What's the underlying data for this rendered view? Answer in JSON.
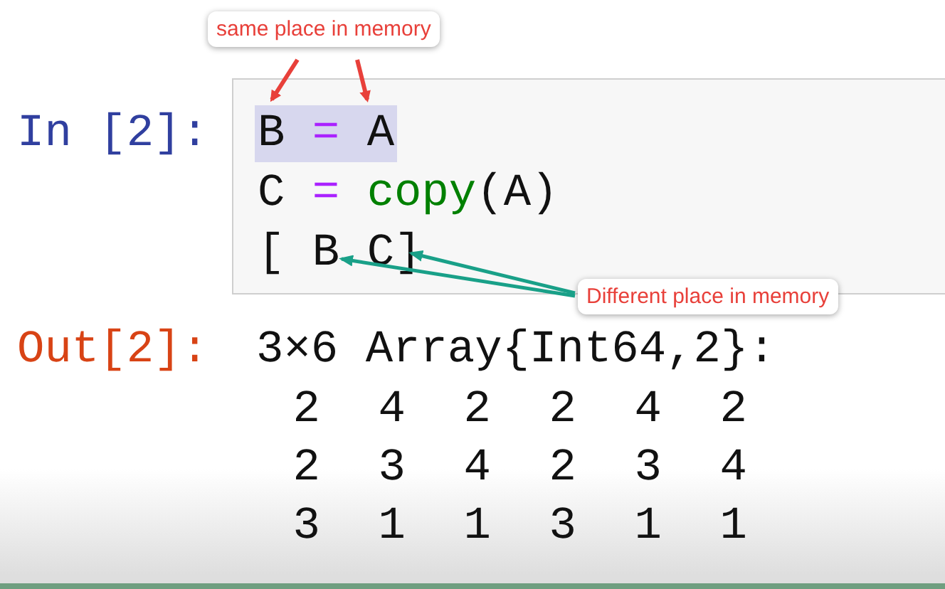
{
  "input_cell": {
    "prompt": "In [2]:",
    "lines": [
      {
        "highlighted": true,
        "tokens": [
          {
            "kind": "plain",
            "text": "B "
          },
          {
            "kind": "op",
            "text": "="
          },
          {
            "kind": "plain",
            "text": " A"
          }
        ]
      },
      {
        "highlighted": false,
        "tokens": [
          {
            "kind": "plain",
            "text": "C "
          },
          {
            "kind": "op",
            "text": "= "
          },
          {
            "kind": "func",
            "text": "copy"
          },
          {
            "kind": "plain",
            "text": "(A)"
          }
        ]
      },
      {
        "highlighted": false,
        "tokens": [
          {
            "kind": "plain",
            "text": "[ B C]"
          }
        ]
      }
    ]
  },
  "output_cell": {
    "prompt": "Out[2]:",
    "header": "3×6 Array{Int64,2}:",
    "rows": [
      [
        "2",
        "4",
        "2",
        "2",
        "4",
        "2"
      ],
      [
        "2",
        "3",
        "4",
        "2",
        "3",
        "4"
      ],
      [
        "3",
        "1",
        "1",
        "3",
        "1",
        "1"
      ]
    ]
  },
  "annotations": [
    {
      "text": "same place in memory"
    },
    {
      "text": "Different place in memory"
    }
  ]
}
